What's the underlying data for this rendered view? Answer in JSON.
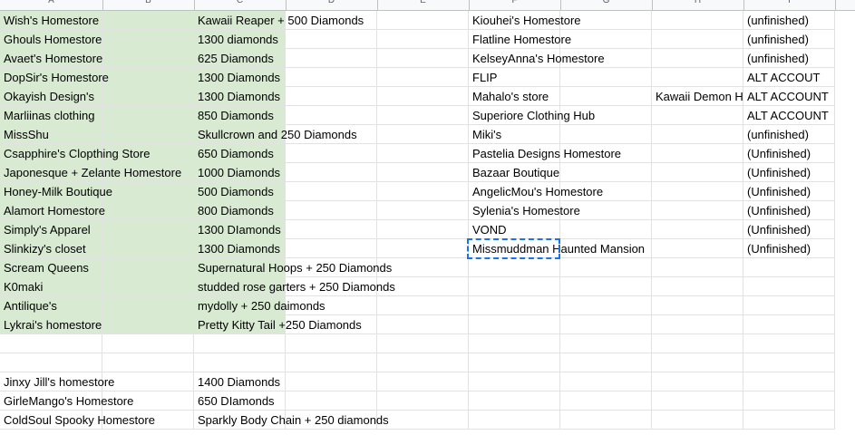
{
  "sheet": {
    "column_headers": [
      "A",
      "B",
      "C",
      "D",
      "E",
      "F",
      "G",
      "H",
      "I"
    ],
    "rows": [
      {
        "a": "Wish's Homestore",
        "c": "Kawaii Reaper + 500 Diamonds",
        "f": "Kiouhei's Homestore",
        "h": "",
        "i": "(unfinished)"
      },
      {
        "a": "Ghouls Homestore",
        "c": "1300 diamonds",
        "f": "Flatline Homestore",
        "h": "",
        "i": "(unfinished)"
      },
      {
        "a": "Avaet's Homestore",
        "c": "625 Diamonds",
        "f": "KelseyAnna's Homestore",
        "h": "",
        "i": "(unfinished)"
      },
      {
        "a": "DopSir's Homestore",
        "c": "1300 Diamonds",
        "f": "FLIP",
        "h": "",
        "i": "ALT ACCOUT"
      },
      {
        "a": "Okayish Design's",
        "c": "1300 Diamonds",
        "f": "Mahalo's store",
        "h": "Kawaii Demon H",
        "i": "ALT ACCOUNT"
      },
      {
        "a": "Marliinas clothing",
        "c": "850 Diamonds",
        "f": " Superiore Clothing Hub",
        "h": "",
        "i": "ALT ACCOUNT"
      },
      {
        "a": "MissShu",
        "c": "Skullcrown and 250 Diamonds",
        "f": "Miki's",
        "h": "",
        "i": "(unfinished)"
      },
      {
        "a": "Csapphire's Clopthing Store",
        "c": "650 Diamonds",
        "f": "Pastelia Designs Homestore",
        "h": "",
        "i": "(Unfinished)"
      },
      {
        "a": "Japonesque + Zelante Homestore",
        "c": "1000 Diamonds",
        "f": "Bazaar Boutique",
        "h": "",
        "i": "(Unfinished)"
      },
      {
        "a": "Honey-Milk Boutique",
        "c": "500 Diamonds",
        "f": "AngelicMou's Homestore",
        "h": "",
        "i": "(Unfinished)"
      },
      {
        "a": "Alamort Homestore",
        "c": "800 Diamonds",
        "f": "Sylenia's Homestore",
        "h": "",
        "i": "(Unfinished)"
      },
      {
        "a": "Simply's Apparel",
        "c": "1300 DIamonds",
        "f": "VOND",
        "h": "",
        "i": "(Unfinished)"
      },
      {
        "a": "Slinkizy's closet",
        "c": "1300 Diamonds",
        "f": "Missmuddman Haunted Mansion",
        "h": "",
        "i": "(Unfinished)"
      },
      {
        "a": "Scream Queens",
        "c": "Supernatural Hoops + 250 Diamonds",
        "f": "",
        "h": "",
        "i": ""
      },
      {
        "a": "K0maki",
        "c": "studded rose garters + 250 Diamonds",
        "f": "",
        "h": "",
        "i": ""
      },
      {
        "a": "Antilique's",
        "c": "mydolly + 250 daimonds",
        "f": "",
        "h": "",
        "i": ""
      },
      {
        "a": "Lykrai's homestore",
        "c": "Pretty Kitty Tail +250 Diamonds",
        "f": "",
        "h": "",
        "i": ""
      },
      {
        "a": "",
        "c": "",
        "f": "",
        "h": "",
        "i": ""
      },
      {
        "a": "",
        "c": "",
        "f": "",
        "h": "",
        "i": ""
      },
      {
        "a": "Jinxy Jill's homestore",
        "c": "1400 Diamonds",
        "f": "",
        "h": "",
        "i": ""
      },
      {
        "a": "GirleMango's Homestore",
        "c": "650 DIamonds",
        "f": "",
        "h": "",
        "i": ""
      },
      {
        "a": "ColdSoul Spooky Homestore",
        "c": "Sparkly Body Chain + 250 diamonds",
        "f": "",
        "h": "",
        "i": ""
      }
    ],
    "highlight_color": "#d9ead3",
    "selection_color": "#1a73e8",
    "selected_cell": "F13"
  }
}
